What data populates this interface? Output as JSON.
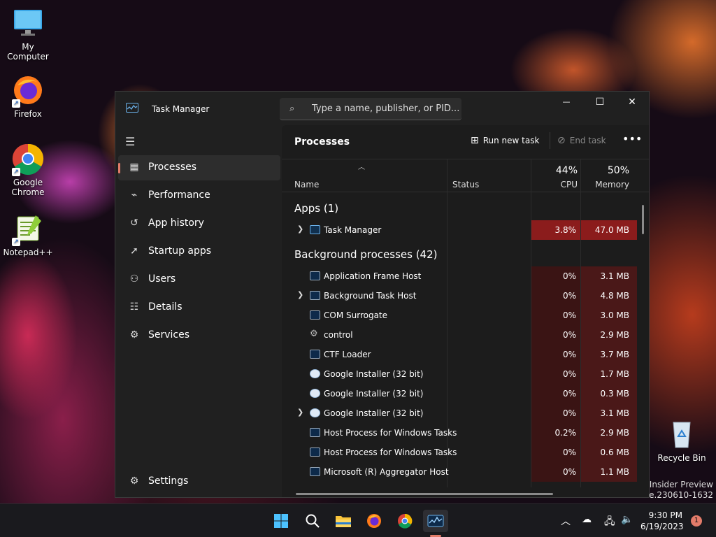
{
  "desktop": {
    "icons": [
      {
        "label": "My Computer",
        "icon": "monitor-icon"
      },
      {
        "label": "Firefox",
        "icon": "firefox-icon"
      },
      {
        "label": "Google Chrome",
        "icon": "chrome-icon"
      },
      {
        "label": "Notepad++",
        "icon": "notepadpp-icon"
      },
      {
        "label": "Recycle Bin",
        "icon": "recycle-bin-icon"
      }
    ],
    "watermark": [
      "ro Insider Preview",
      "lease.230610-1632"
    ]
  },
  "window": {
    "title": "Task Manager",
    "search_placeholder": "Type a name, publisher, or PID...",
    "controls": {
      "minimize": "—",
      "maximize": "☐",
      "close": "✕"
    }
  },
  "sidebar": {
    "items": [
      {
        "label": "Processes",
        "icon": "processes-icon",
        "active": true
      },
      {
        "label": "Performance",
        "icon": "performance-icon"
      },
      {
        "label": "App history",
        "icon": "history-icon"
      },
      {
        "label": "Startup apps",
        "icon": "startup-icon"
      },
      {
        "label": "Users",
        "icon": "users-icon"
      },
      {
        "label": "Details",
        "icon": "details-icon"
      },
      {
        "label": "Services",
        "icon": "services-icon"
      }
    ],
    "settings_label": "Settings"
  },
  "main": {
    "title": "Processes",
    "run_new_task": "Run new task",
    "end_task": "End task",
    "more": "•••",
    "columns": {
      "name": "Name",
      "status": "Status",
      "cpu_pct": "44%",
      "cpu_label": "CPU",
      "mem_pct": "50%",
      "mem_label": "Memory"
    },
    "apps_group": "Apps (1)",
    "apps": [
      {
        "name": "Task Manager",
        "cpu": "3.8%",
        "mem": "47.0 MB",
        "expandable": true
      }
    ],
    "bg_group": "Background processes (42)",
    "background": [
      {
        "name": "Application Frame Host",
        "cpu": "0%",
        "mem": "3.1 MB"
      },
      {
        "name": "Background Task Host",
        "cpu": "0%",
        "mem": "4.8 MB",
        "expandable": true
      },
      {
        "name": "COM Surrogate",
        "cpu": "0%",
        "mem": "3.0 MB"
      },
      {
        "name": "control",
        "cpu": "0%",
        "mem": "2.9 MB"
      },
      {
        "name": "CTF Loader",
        "cpu": "0%",
        "mem": "3.7 MB"
      },
      {
        "name": "Google Installer (32 bit)",
        "cpu": "0%",
        "mem": "1.7 MB"
      },
      {
        "name": "Google Installer (32 bit)",
        "cpu": "0%",
        "mem": "0.3 MB"
      },
      {
        "name": "Google Installer (32 bit)",
        "cpu": "0%",
        "mem": "3.1 MB",
        "expandable": true
      },
      {
        "name": "Host Process for Windows Tasks",
        "cpu": "0.2%",
        "mem": "2.9 MB"
      },
      {
        "name": "Host Process for Windows Tasks",
        "cpu": "0%",
        "mem": "0.6 MB"
      },
      {
        "name": "Microsoft (R) Aggregator Host",
        "cpu": "0%",
        "mem": "1.1 MB"
      }
    ]
  },
  "taskbar": {
    "time": "9:30 PM",
    "date": "6/19/2023",
    "notifications": "1"
  },
  "colors": {
    "accent": "#e37c6a",
    "heat_high": "#8b1c1c",
    "heat_low": "#3a1414",
    "window_bg": "#202020"
  }
}
